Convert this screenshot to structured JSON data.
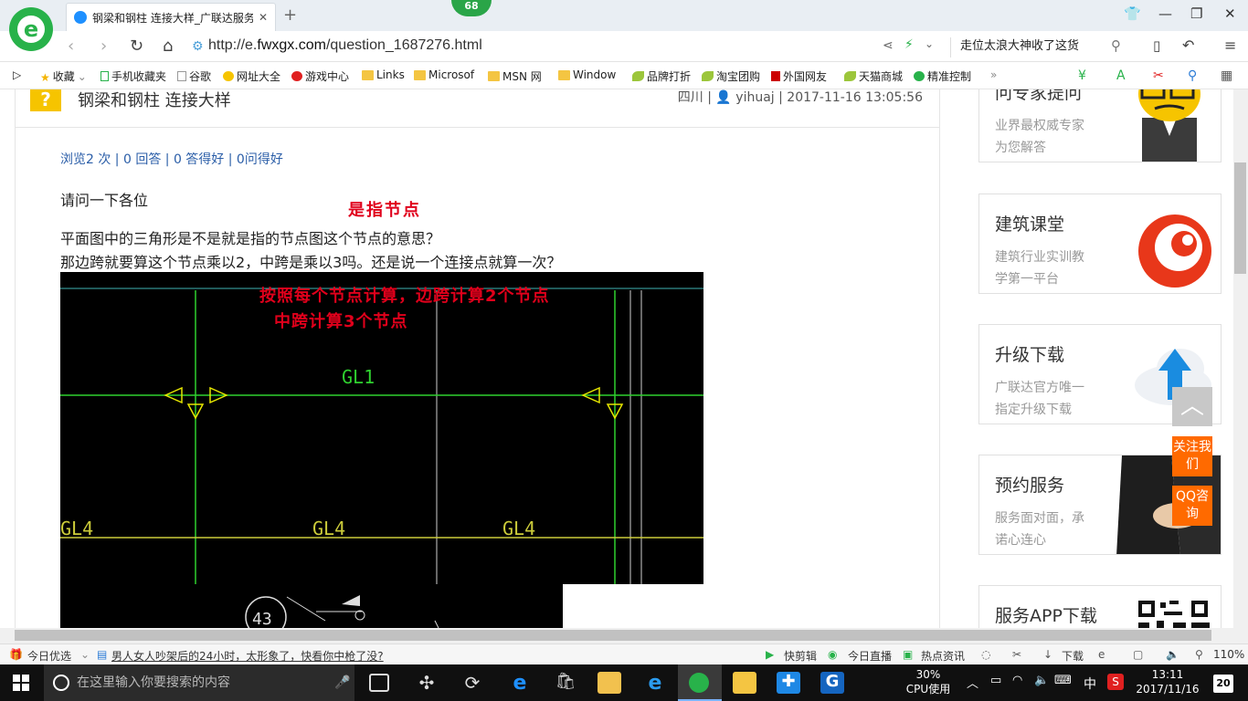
{
  "browser": {
    "tab_title": "钢梁和钢柱 连接大样_广联达服务",
    "badge": "68",
    "url_prefix": "http://e.",
    "url_domain": "fwxgx.com",
    "url_path": "/question_1687276.html",
    "right_search_text": "走位太浪大神收了这货"
  },
  "bookmarks": [
    {
      "label": "收藏"
    },
    {
      "label": "手机收藏夹"
    },
    {
      "label": "谷歌"
    },
    {
      "label": "网址大全"
    },
    {
      "label": "游戏中心"
    },
    {
      "label": "Links"
    },
    {
      "label": "Microsof"
    },
    {
      "label": "MSN 网"
    },
    {
      "label": "Window"
    },
    {
      "label": "品牌打折"
    },
    {
      "label": "淘宝团购"
    },
    {
      "label": "外国网友"
    },
    {
      "label": "天猫商城"
    },
    {
      "label": "精准控制"
    }
  ],
  "question": {
    "title": "钢梁和钢柱 连接大样",
    "region": "四川",
    "user": "yihuaj",
    "datetime": "2017-11-16 13:05:56",
    "stats": "浏览2 次 | 0 回答 | 0 答得好 | 0问得好",
    "greeting": "请问一下各位",
    "line1": "平面图中的三角形是不是就是指的节点图这个节点的意思？",
    "line2": "那边跨就要算这个节点乘以2，中跨是乘以3吗。还是说一个连接点就算一次？",
    "annotation_top": "是指节点",
    "annotation_img_1": "按照每个节点计算，边跨计算2个节点",
    "annotation_img_2": "中跨计算3个节点"
  },
  "cad": {
    "labels": [
      "GL1",
      "GL4",
      "GL4",
      "GL4",
      "43"
    ]
  },
  "sidebar": {
    "cards": [
      {
        "title": "问专家提问",
        "sub1": "业界最权威专家",
        "sub2": "为您解答"
      },
      {
        "title": "建筑课堂",
        "sub1": "建筑行业实训教",
        "sub2": "学第一平台"
      },
      {
        "title": "升级下载",
        "sub1": "广联达官方唯一",
        "sub2": "指定升级下载"
      },
      {
        "title": "预约服务",
        "sub1": "服务面对面，承",
        "sub2": "诺心连心"
      },
      {
        "title": "服务APP下载",
        "sub1": "",
        "sub2": ""
      }
    ],
    "follow": "关注我们",
    "qq": "QQ咨询"
  },
  "statusbar": {
    "today": "今日优选",
    "news": "男人女人吵架后的24小时，太形象了，快看你中枪了没?",
    "kuaijian": "快剪辑",
    "live": "今日直播",
    "hot": "热点资讯",
    "download": "下载",
    "zoom": "110%"
  },
  "taskbar": {
    "search_placeholder": "在这里输入你要搜索的内容",
    "cpu_percent": "30%",
    "cpu_label": "CPU使用",
    "ime": "中",
    "time": "13:11",
    "date": "2017/11/16",
    "notifications": "20"
  },
  "colors": {
    "accent_green": "#28b24a",
    "annotation_red": "#e0001b",
    "link_blue": "#2b5ea8",
    "side_orange": "#ff6a00"
  }
}
